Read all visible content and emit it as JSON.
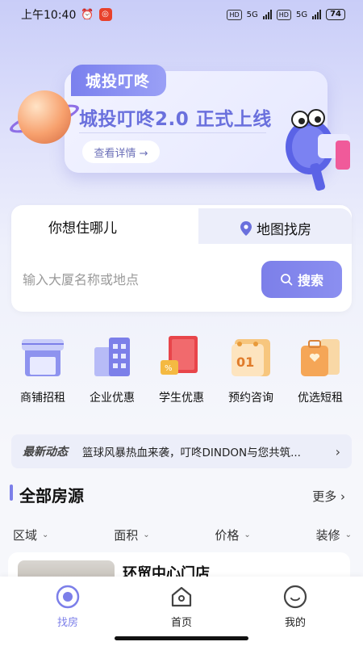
{
  "status_bar": {
    "time": "上午10:40",
    "network1": "5G",
    "network2": "5G",
    "hd1": "HD",
    "hd2": "HD",
    "battery": "74"
  },
  "banner": {
    "tag": "城投叮咚",
    "title": "城投叮咚2.0 正式上线",
    "button": "查看详情 →"
  },
  "search": {
    "tab_want": "你想住哪儿",
    "tab_map": "地图找房",
    "placeholder": "输入大厦名称或地点",
    "button": "搜索"
  },
  "categories": [
    {
      "label": "商铺招租",
      "icon": "shop-icon"
    },
    {
      "label": "企业优惠",
      "icon": "office-building-icon"
    },
    {
      "label": "学生优惠",
      "icon": "book-icon"
    },
    {
      "label": "预约咨询",
      "icon": "calendar-icon"
    },
    {
      "label": "优选短租",
      "icon": "suitcase-icon"
    }
  ],
  "news": {
    "tag": "最新动态",
    "text": "篮球风暴热血来袭，叮咚DINDON与您共筑..."
  },
  "section": {
    "title": "全部房源",
    "more": "更多"
  },
  "filters": [
    "区域",
    "面积",
    "价格",
    "装修"
  ],
  "listing": {
    "title": "环贸中心门店"
  },
  "bottom_nav": [
    {
      "label": "找房",
      "icon": "find-house-icon",
      "active": true
    },
    {
      "label": "首页",
      "icon": "home-icon",
      "active": false
    },
    {
      "label": "我的",
      "icon": "profile-icon",
      "active": false
    }
  ],
  "colors": {
    "accent": "#7c7fe9",
    "banner_title": "#6a70dd"
  }
}
